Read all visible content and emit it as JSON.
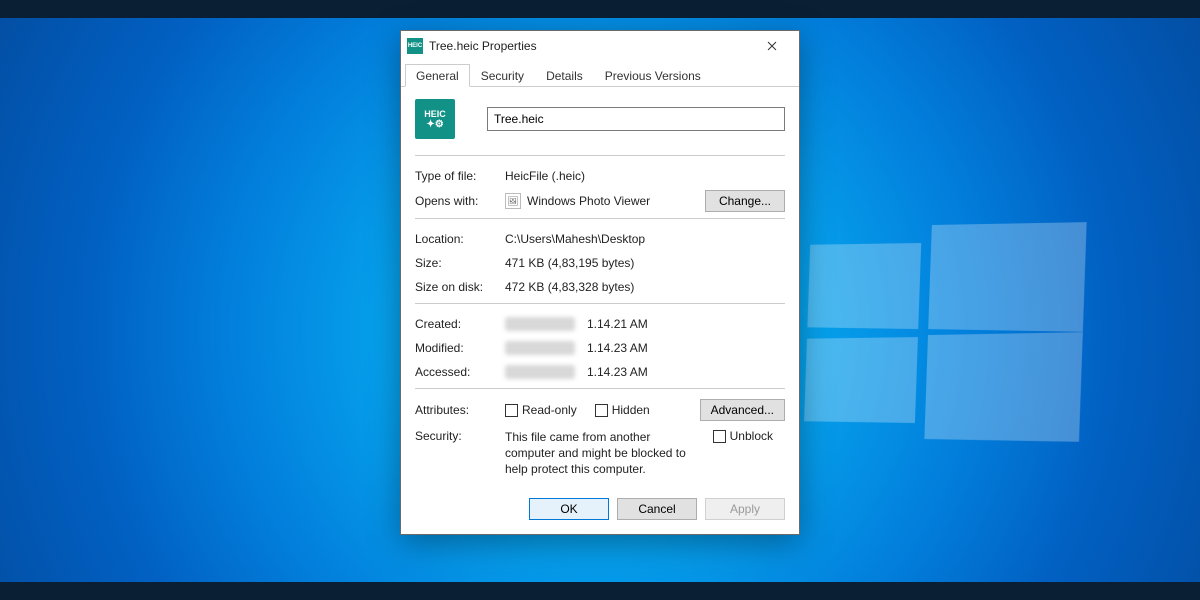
{
  "window": {
    "title": "Tree.heic Properties"
  },
  "tabs": {
    "general": "General",
    "security": "Security",
    "details": "Details",
    "previous": "Previous Versions"
  },
  "file": {
    "icon_label": "HEIC",
    "name": "Tree.heic",
    "type_label": "Type of file:",
    "type_value": "HeicFile (.heic)",
    "opens_label": "Opens with:",
    "opens_app": "Windows Photo Viewer",
    "change_btn": "Change...",
    "location_label": "Location:",
    "location_value": "C:\\Users\\Mahesh\\Desktop",
    "size_label": "Size:",
    "size_value": "471 KB (4,83,195 bytes)",
    "disk_label": "Size on disk:",
    "disk_value": "472 KB (4,83,328 bytes)",
    "created_label": "Created:",
    "created_time": "1.14.21 AM",
    "modified_label": "Modified:",
    "modified_time": "1.14.23 AM",
    "accessed_label": "Accessed:",
    "accessed_time": "1.14.23 AM",
    "attr_label": "Attributes:",
    "readonly": "Read-only",
    "hidden": "Hidden",
    "advanced_btn": "Advanced...",
    "sec_label": "Security:",
    "sec_text": "This file came from another computer and might be blocked to help protect this computer.",
    "unblock": "Unblock"
  },
  "buttons": {
    "ok": "OK",
    "cancel": "Cancel",
    "apply": "Apply"
  }
}
